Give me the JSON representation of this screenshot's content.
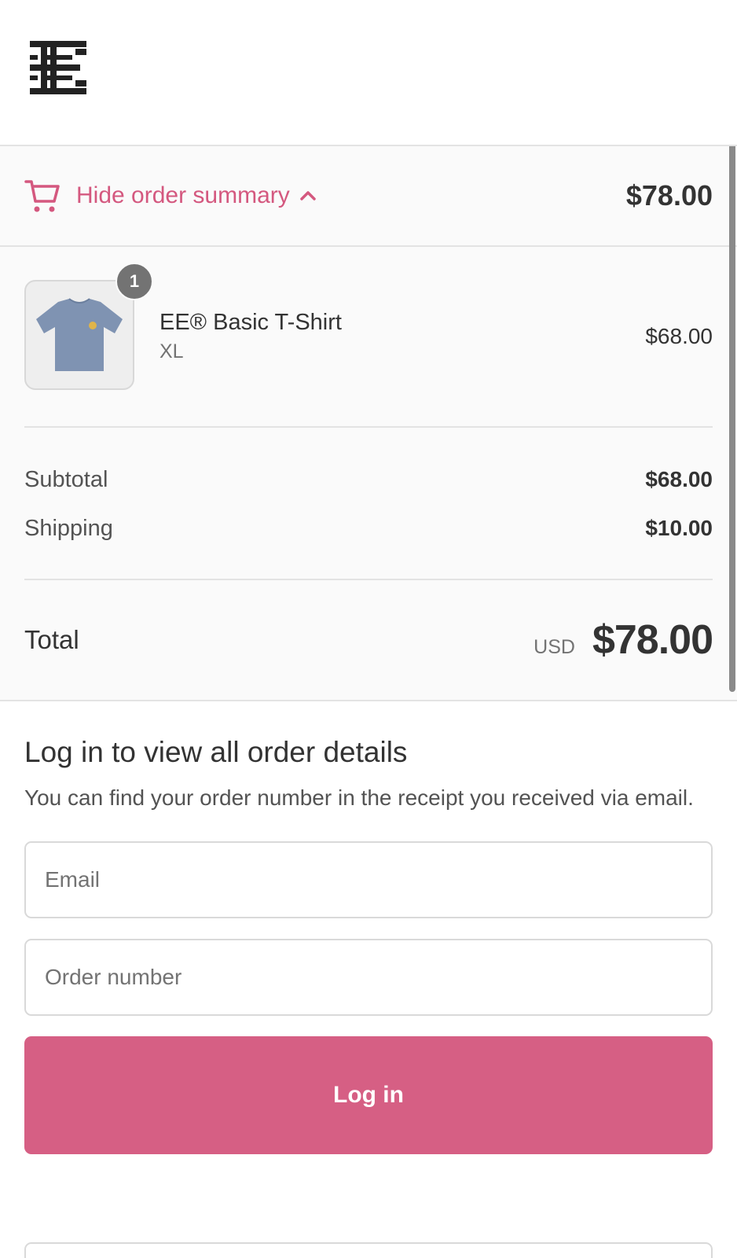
{
  "header": {
    "logo_icon": "ee-monogram-logo"
  },
  "summary_toggle": {
    "icon": "cart-icon",
    "label": "Hide order summary",
    "chevron_icon": "chevron-up-icon",
    "total": "$78.00"
  },
  "line_items": [
    {
      "quantity": "1",
      "name": "EE® Basic T-Shirt",
      "variant": "XL",
      "price": "$68.00",
      "thumbnail_icon": "tshirt-icon"
    }
  ],
  "costs": {
    "subtotal_label": "Subtotal",
    "subtotal_value": "$68.00",
    "shipping_label": "Shipping",
    "shipping_value": "$10.00"
  },
  "total": {
    "label": "Total",
    "currency": "USD",
    "amount": "$78.00"
  },
  "login": {
    "title": "Log in to view all order details",
    "description": "You can find your order number in the receipt you received via email.",
    "email_placeholder": "Email",
    "order_number_placeholder": "Order number",
    "button_label": "Log in"
  },
  "colors": {
    "accent": "#d65f84",
    "link": "#d4587f",
    "panel_bg": "#fafafa",
    "border": "#e3e3e3"
  }
}
